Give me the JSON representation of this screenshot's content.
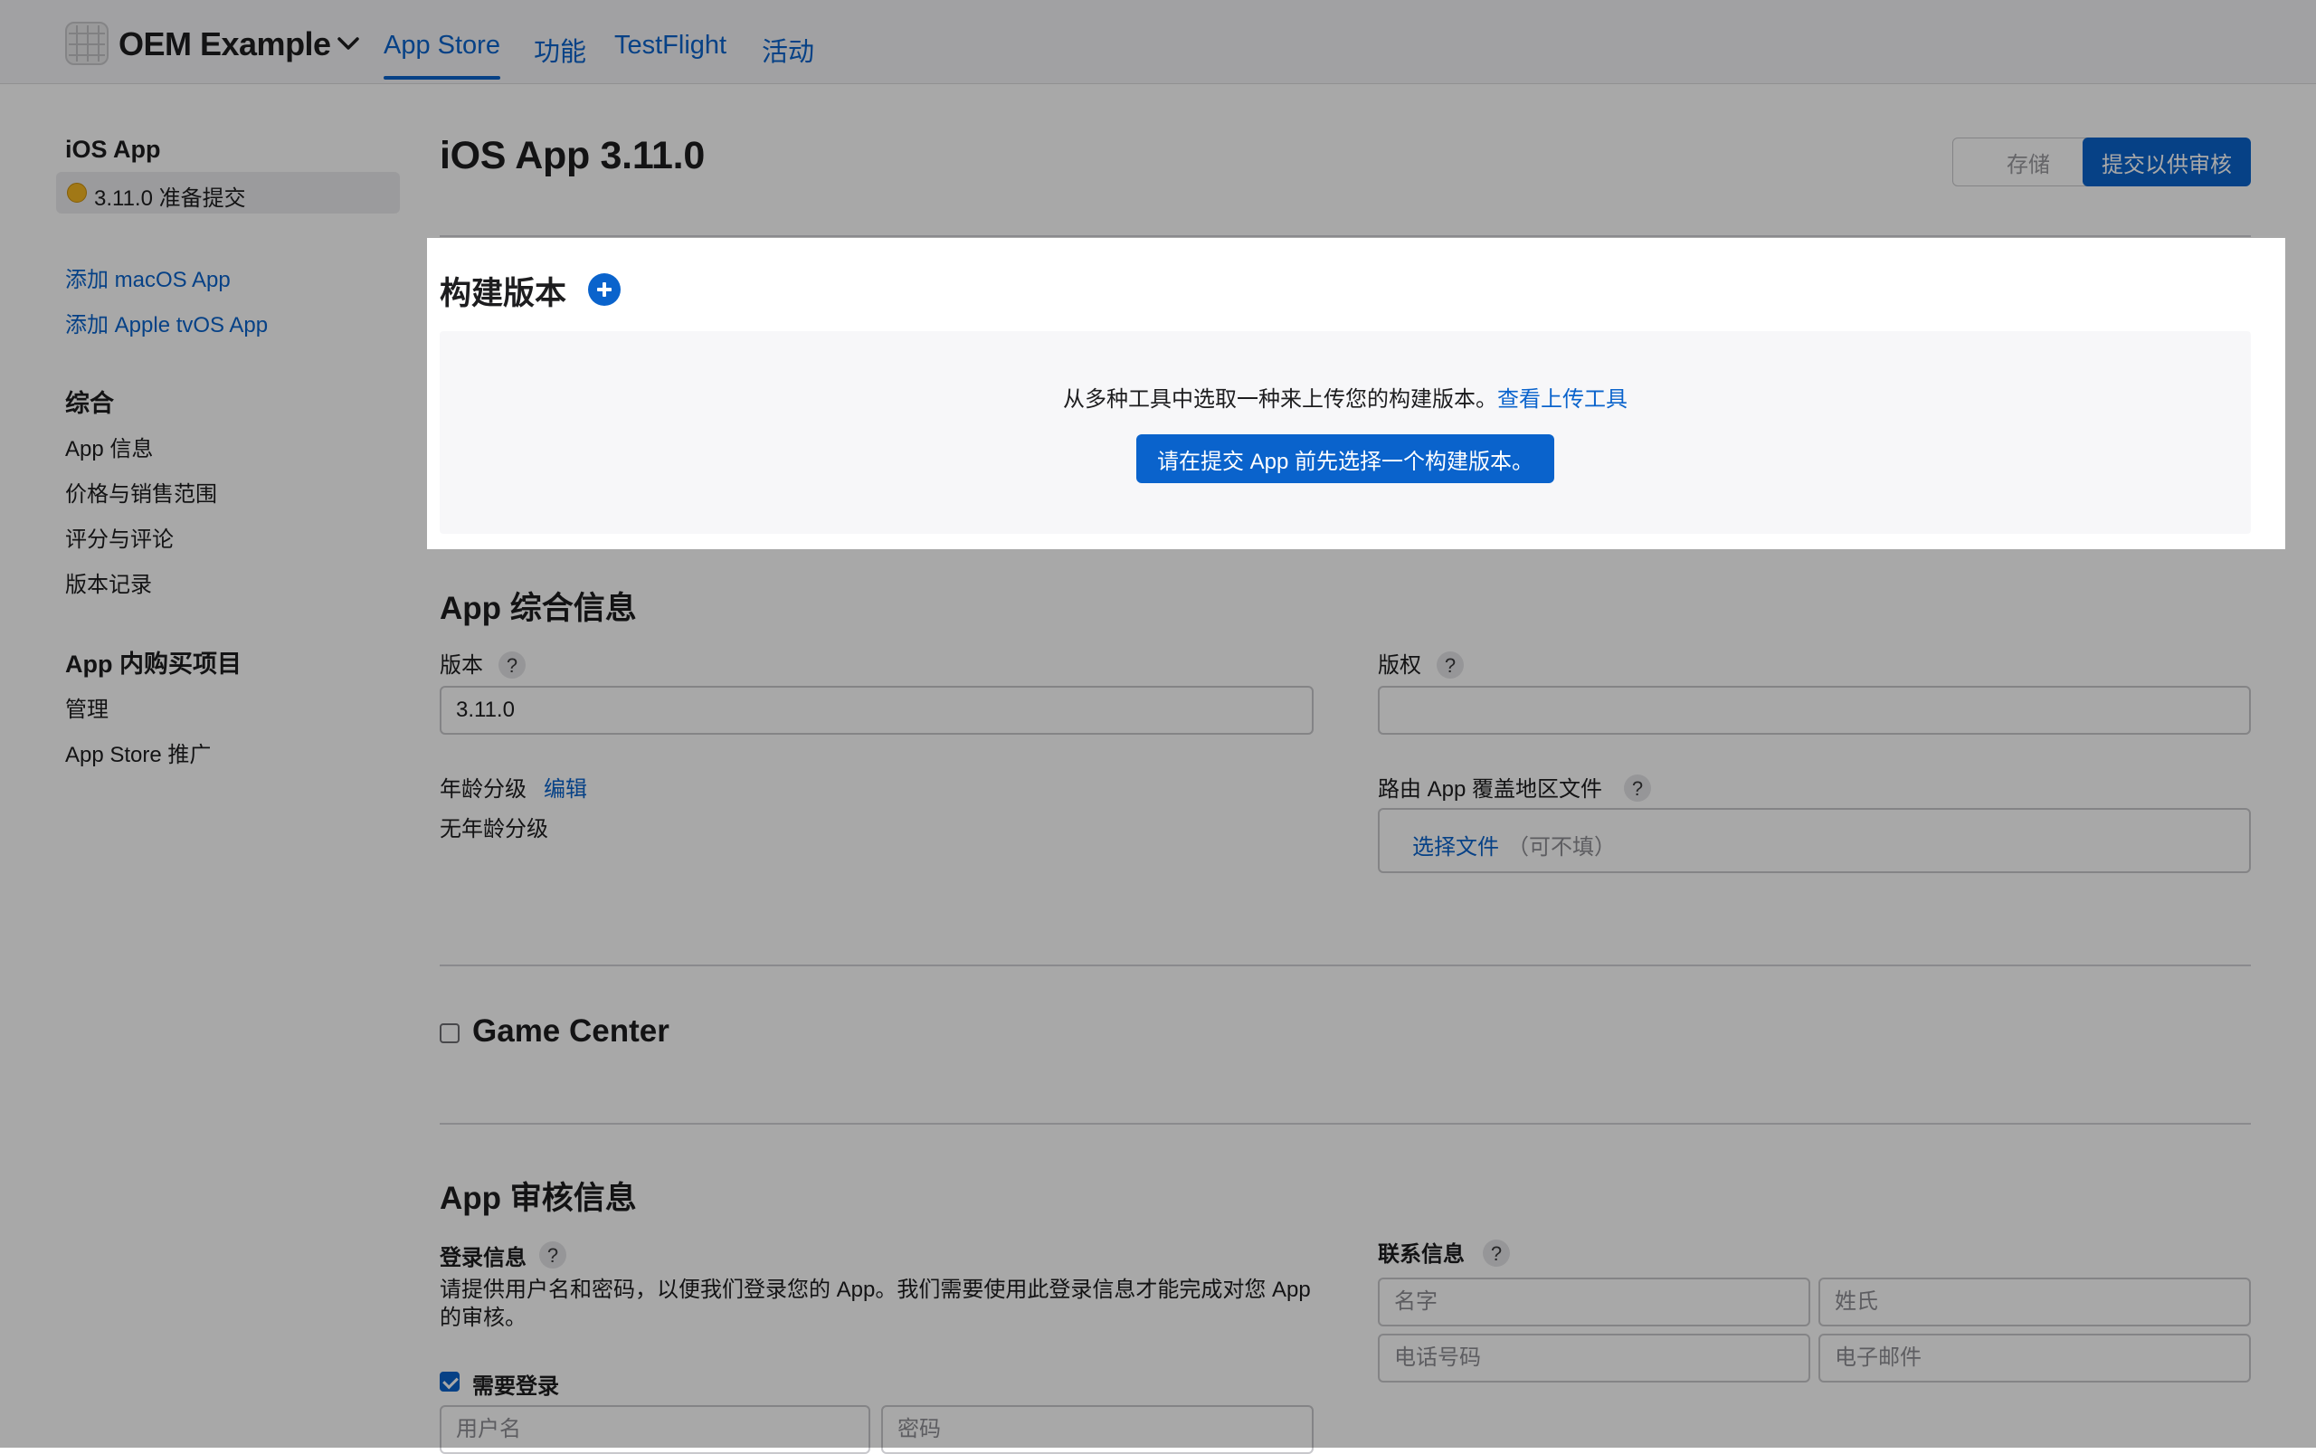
{
  "colors": {
    "accent": "#0a63cc",
    "status_pending": "#f5b622"
  },
  "nav": {
    "brand": "OEM Example",
    "tabs": [
      {
        "label": "App Store",
        "active": true
      },
      {
        "label": "功能",
        "active": false
      },
      {
        "label": "TestFlight",
        "active": false
      },
      {
        "label": "活动",
        "active": false
      }
    ]
  },
  "sidebar": {
    "platform_title": "iOS App",
    "selected_version": "3.11.0 准备提交",
    "add_links": [
      "添加 macOS App",
      "添加 Apple tvOS App"
    ],
    "general_title": "综合",
    "general_items": [
      "App 信息",
      "价格与销售范围",
      "评分与评论",
      "版本记录"
    ],
    "iap_title": "App 内购买项目",
    "iap_items": [
      "管理",
      "App Store 推广"
    ]
  },
  "header": {
    "title": "iOS App 3.11.0",
    "save_label": "存储",
    "submit_label": "提交以供审核"
  },
  "build": {
    "heading": "构建版本",
    "message": "从多种工具中选取一种来上传您的构建版本。",
    "message_link": "查看上传工具",
    "select_button": "请在提交 App 前先选择一个构建版本。"
  },
  "general_info": {
    "heading": "App 综合信息",
    "version_label": "版本",
    "version_value": "3.11.0",
    "copyright_label": "版权",
    "copyright_value": "",
    "age_label": "年龄分级",
    "age_edit": "编辑",
    "age_value": "无年龄分级",
    "routing_label": "路由 App 覆盖地区文件",
    "routing_choose": "选择文件",
    "routing_optional": "（可不填）",
    "help_glyph": "?"
  },
  "game_center": {
    "label": "Game Center",
    "checked": false
  },
  "review_info": {
    "heading": "App 审核信息",
    "login_label": "登录信息",
    "login_desc_line1": "请提供用户名和密码，以便我们登录您的 App。我们需要使用此登录信息才能完成对您 App",
    "login_desc_line2": "的审核。",
    "requires_login_label": "需要登录",
    "requires_login_checked": true,
    "username_placeholder": "用户名",
    "password_placeholder": "密码",
    "contact_label": "联系信息",
    "first_name_placeholder": "名字",
    "last_name_placeholder": "姓氏",
    "phone_placeholder": "电话号码",
    "email_placeholder": "电子邮件"
  }
}
